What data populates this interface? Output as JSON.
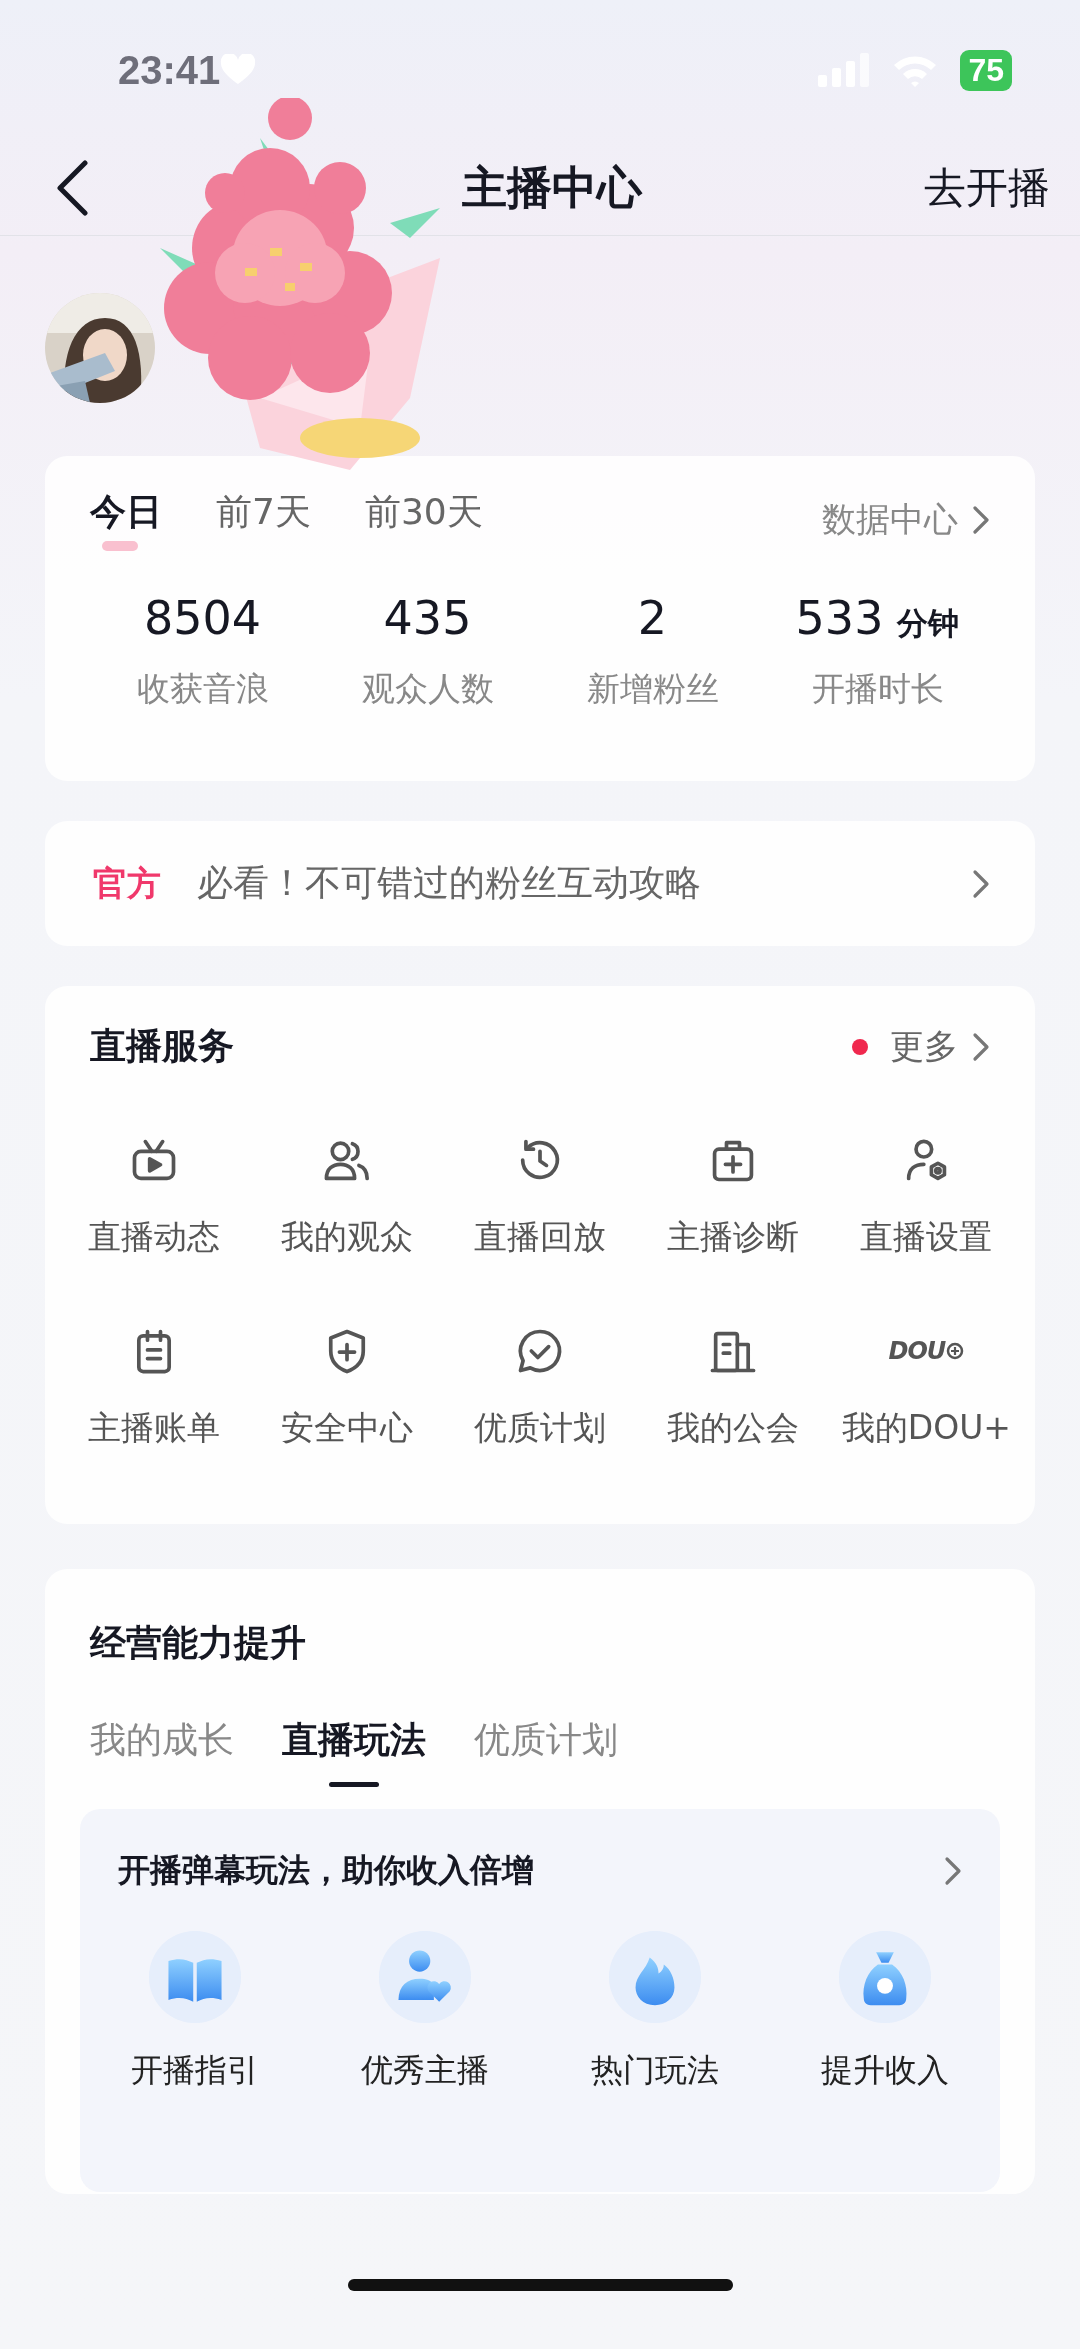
{
  "status_bar": {
    "time": "23:41",
    "battery": "75"
  },
  "nav": {
    "title": "主播中心",
    "action": "去开播"
  },
  "stats_card": {
    "periods": [
      {
        "label": "今日",
        "selected": true
      },
      {
        "label": "前7天",
        "selected": false
      },
      {
        "label": "前30天",
        "selected": false
      }
    ],
    "link": "数据中心",
    "stats": [
      {
        "value": "8504",
        "label": "收获音浪"
      },
      {
        "value": "435",
        "label": "观众人数"
      },
      {
        "value": "2",
        "label": "新增粉丝"
      },
      {
        "value": "533",
        "unit": "分钟",
        "label": "开播时长"
      }
    ]
  },
  "notice": {
    "tag": "官方",
    "text": "必看！不可错过的粉丝互动攻略"
  },
  "live_services": {
    "title": "直播服务",
    "more": "更多",
    "new_badge": true,
    "items": [
      {
        "label": "直播动态",
        "kind": "tv"
      },
      {
        "label": "我的观众",
        "kind": "audience"
      },
      {
        "label": "直播回放",
        "kind": "replay"
      },
      {
        "label": "主播诊断",
        "kind": "diagnose"
      },
      {
        "label": "直播设置",
        "kind": "settings"
      },
      {
        "label": "主播账单",
        "kind": "bill"
      },
      {
        "label": "安全中心",
        "kind": "shield"
      },
      {
        "label": "优质计划",
        "kind": "quality"
      },
      {
        "label": "我的公会",
        "kind": "guild"
      },
      {
        "label": "我的DOU+",
        "kind": "dou",
        "icon_text": "DOU"
      }
    ]
  },
  "growth": {
    "title": "经营能力提升",
    "tabs": [
      {
        "label": "我的成长",
        "selected": false
      },
      {
        "label": "直播玩法",
        "selected": true
      },
      {
        "label": "优质计划",
        "selected": false
      }
    ],
    "panel": {
      "title": "开播弹幕玩法，助你收入倍增",
      "items": [
        {
          "label": "开播指引",
          "kind": "book"
        },
        {
          "label": "优秀主播",
          "kind": "fan"
        },
        {
          "label": "热门玩法",
          "kind": "flame"
        },
        {
          "label": "提升收入",
          "kind": "bag"
        }
      ]
    }
  }
}
